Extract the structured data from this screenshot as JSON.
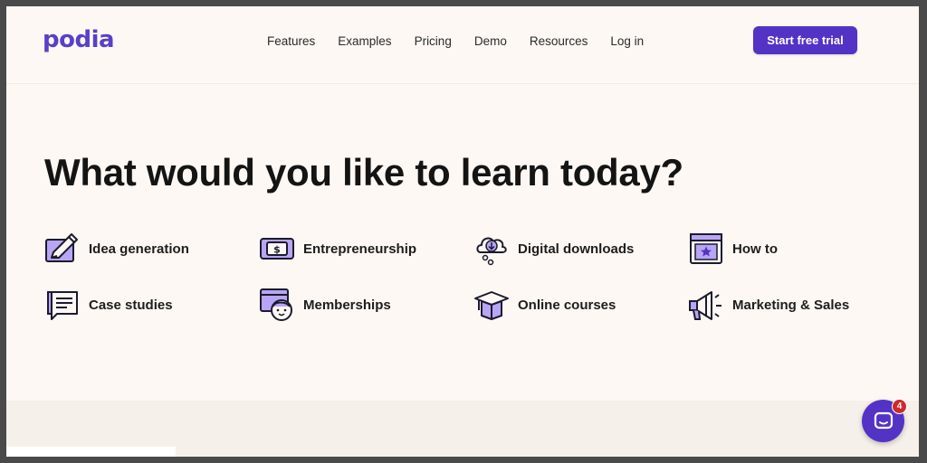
{
  "header": {
    "logo": "podia",
    "nav": [
      "Features",
      "Examples",
      "Pricing",
      "Demo",
      "Resources",
      "Log in"
    ],
    "cta_label": "Start free trial"
  },
  "hero": {
    "title": "What would you like to learn today?"
  },
  "topics": [
    {
      "label": "Idea generation",
      "icon": "pencil-note-icon"
    },
    {
      "label": "Entrepreneurship",
      "icon": "dollar-bill-icon"
    },
    {
      "label": "Digital downloads",
      "icon": "cloud-download-icon"
    },
    {
      "label": "How to",
      "icon": "star-window-icon"
    },
    {
      "label": "Case studies",
      "icon": "speech-bubble-icon"
    },
    {
      "label": "Memberships",
      "icon": "member-face-icon"
    },
    {
      "label": "Online courses",
      "icon": "graduation-cap-icon"
    },
    {
      "label": "Marketing & Sales",
      "icon": "megaphone-icon"
    }
  ],
  "chat": {
    "badge_count": "4",
    "icon": "chat-icon"
  },
  "colors": {
    "brand": "#5233c6",
    "background": "#fdf8f3",
    "badge": "#d0282a"
  }
}
